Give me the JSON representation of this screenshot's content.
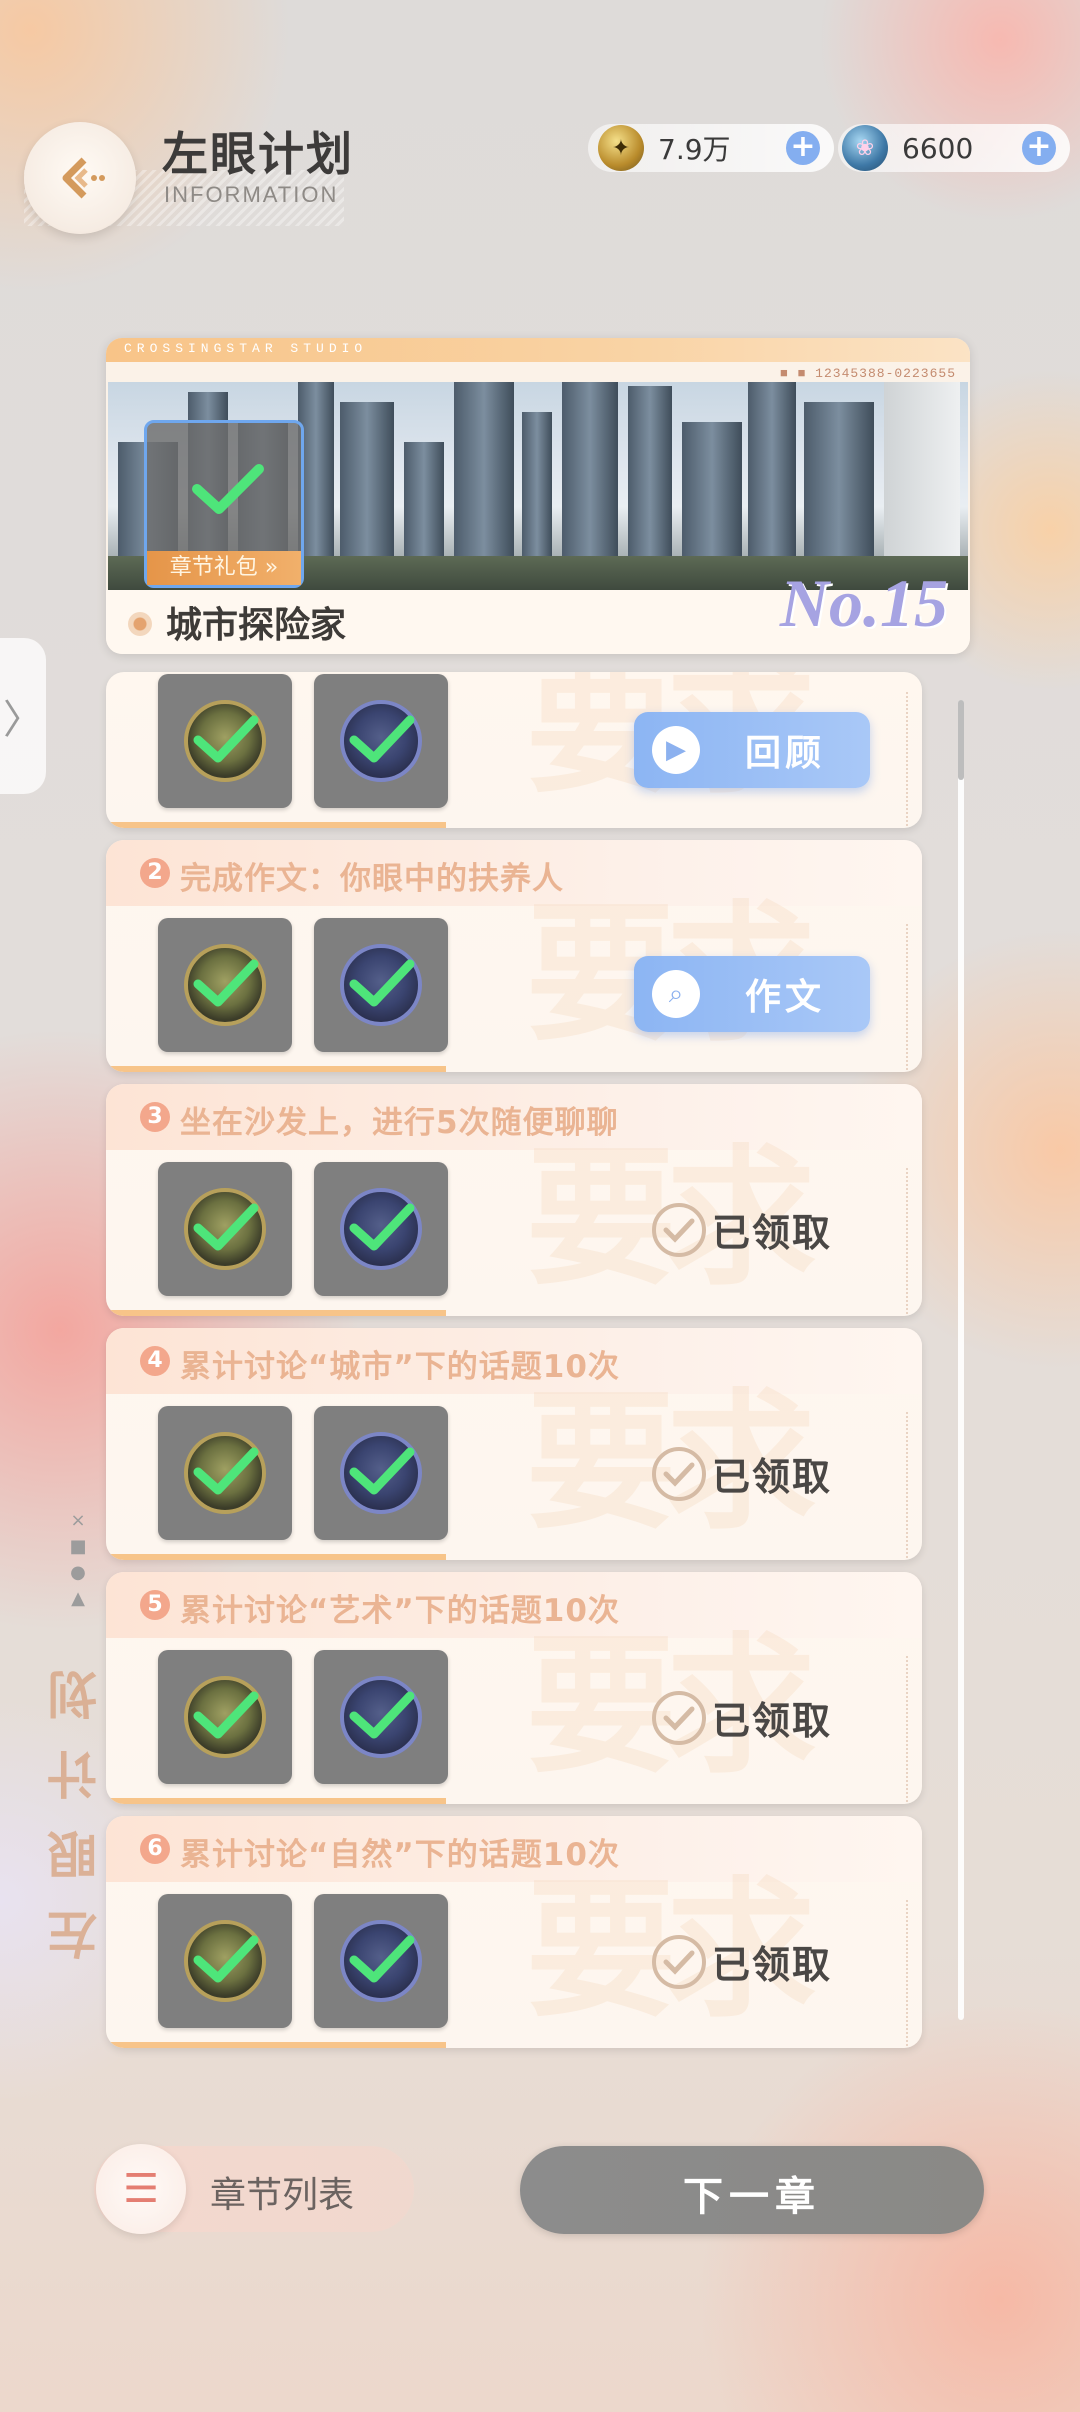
{
  "header": {
    "title": "左眼计划",
    "subtitle": "INFORMATION",
    "currency": [
      {
        "icon": "gold-coin-icon",
        "value": "7.9万"
      },
      {
        "icon": "brain-gem-icon",
        "value": "6600"
      }
    ]
  },
  "side": {
    "vertical_label": "左眼计划",
    "deco": "×\n■\n●\n▲"
  },
  "banner": {
    "studio": "CROSSINGSTAR STUDIO",
    "serial": "■ ■ 12345388-0223655",
    "gift_label": "章节礼包",
    "gift_arrow": "»",
    "chapter_title": "城市探险家",
    "chapter_no": "No.15"
  },
  "tasks": [
    {
      "num": "",
      "title": "",
      "action": {
        "type": "button",
        "label": "回顾",
        "icon": "play-icon"
      }
    },
    {
      "num": "2",
      "title": "完成作文：你眼中的扶养人",
      "action": {
        "type": "button",
        "label": "作文",
        "icon": "search-icon"
      }
    },
    {
      "num": "3",
      "title": "坐在沙发上，进行5次随便聊聊",
      "action": {
        "type": "claimed",
        "label": "已领取"
      }
    },
    {
      "num": "4",
      "title": "累计讨论“城市”下的话题10次",
      "action": {
        "type": "claimed",
        "label": "已领取"
      }
    },
    {
      "num": "5",
      "title": "累计讨论“艺术”下的话题10次",
      "action": {
        "type": "claimed",
        "label": "已领取"
      }
    },
    {
      "num": "6",
      "title": "累计讨论“自然”下的话题10次",
      "action": {
        "type": "claimed",
        "label": "已领取"
      }
    }
  ],
  "footer": {
    "chapter_list_label": "章节列表",
    "next_label": "下一章"
  },
  "colors": {
    "accent_blue": "#8cb5f3",
    "accent_orange": "#f7c489",
    "check_green": "#4ee57a"
  }
}
